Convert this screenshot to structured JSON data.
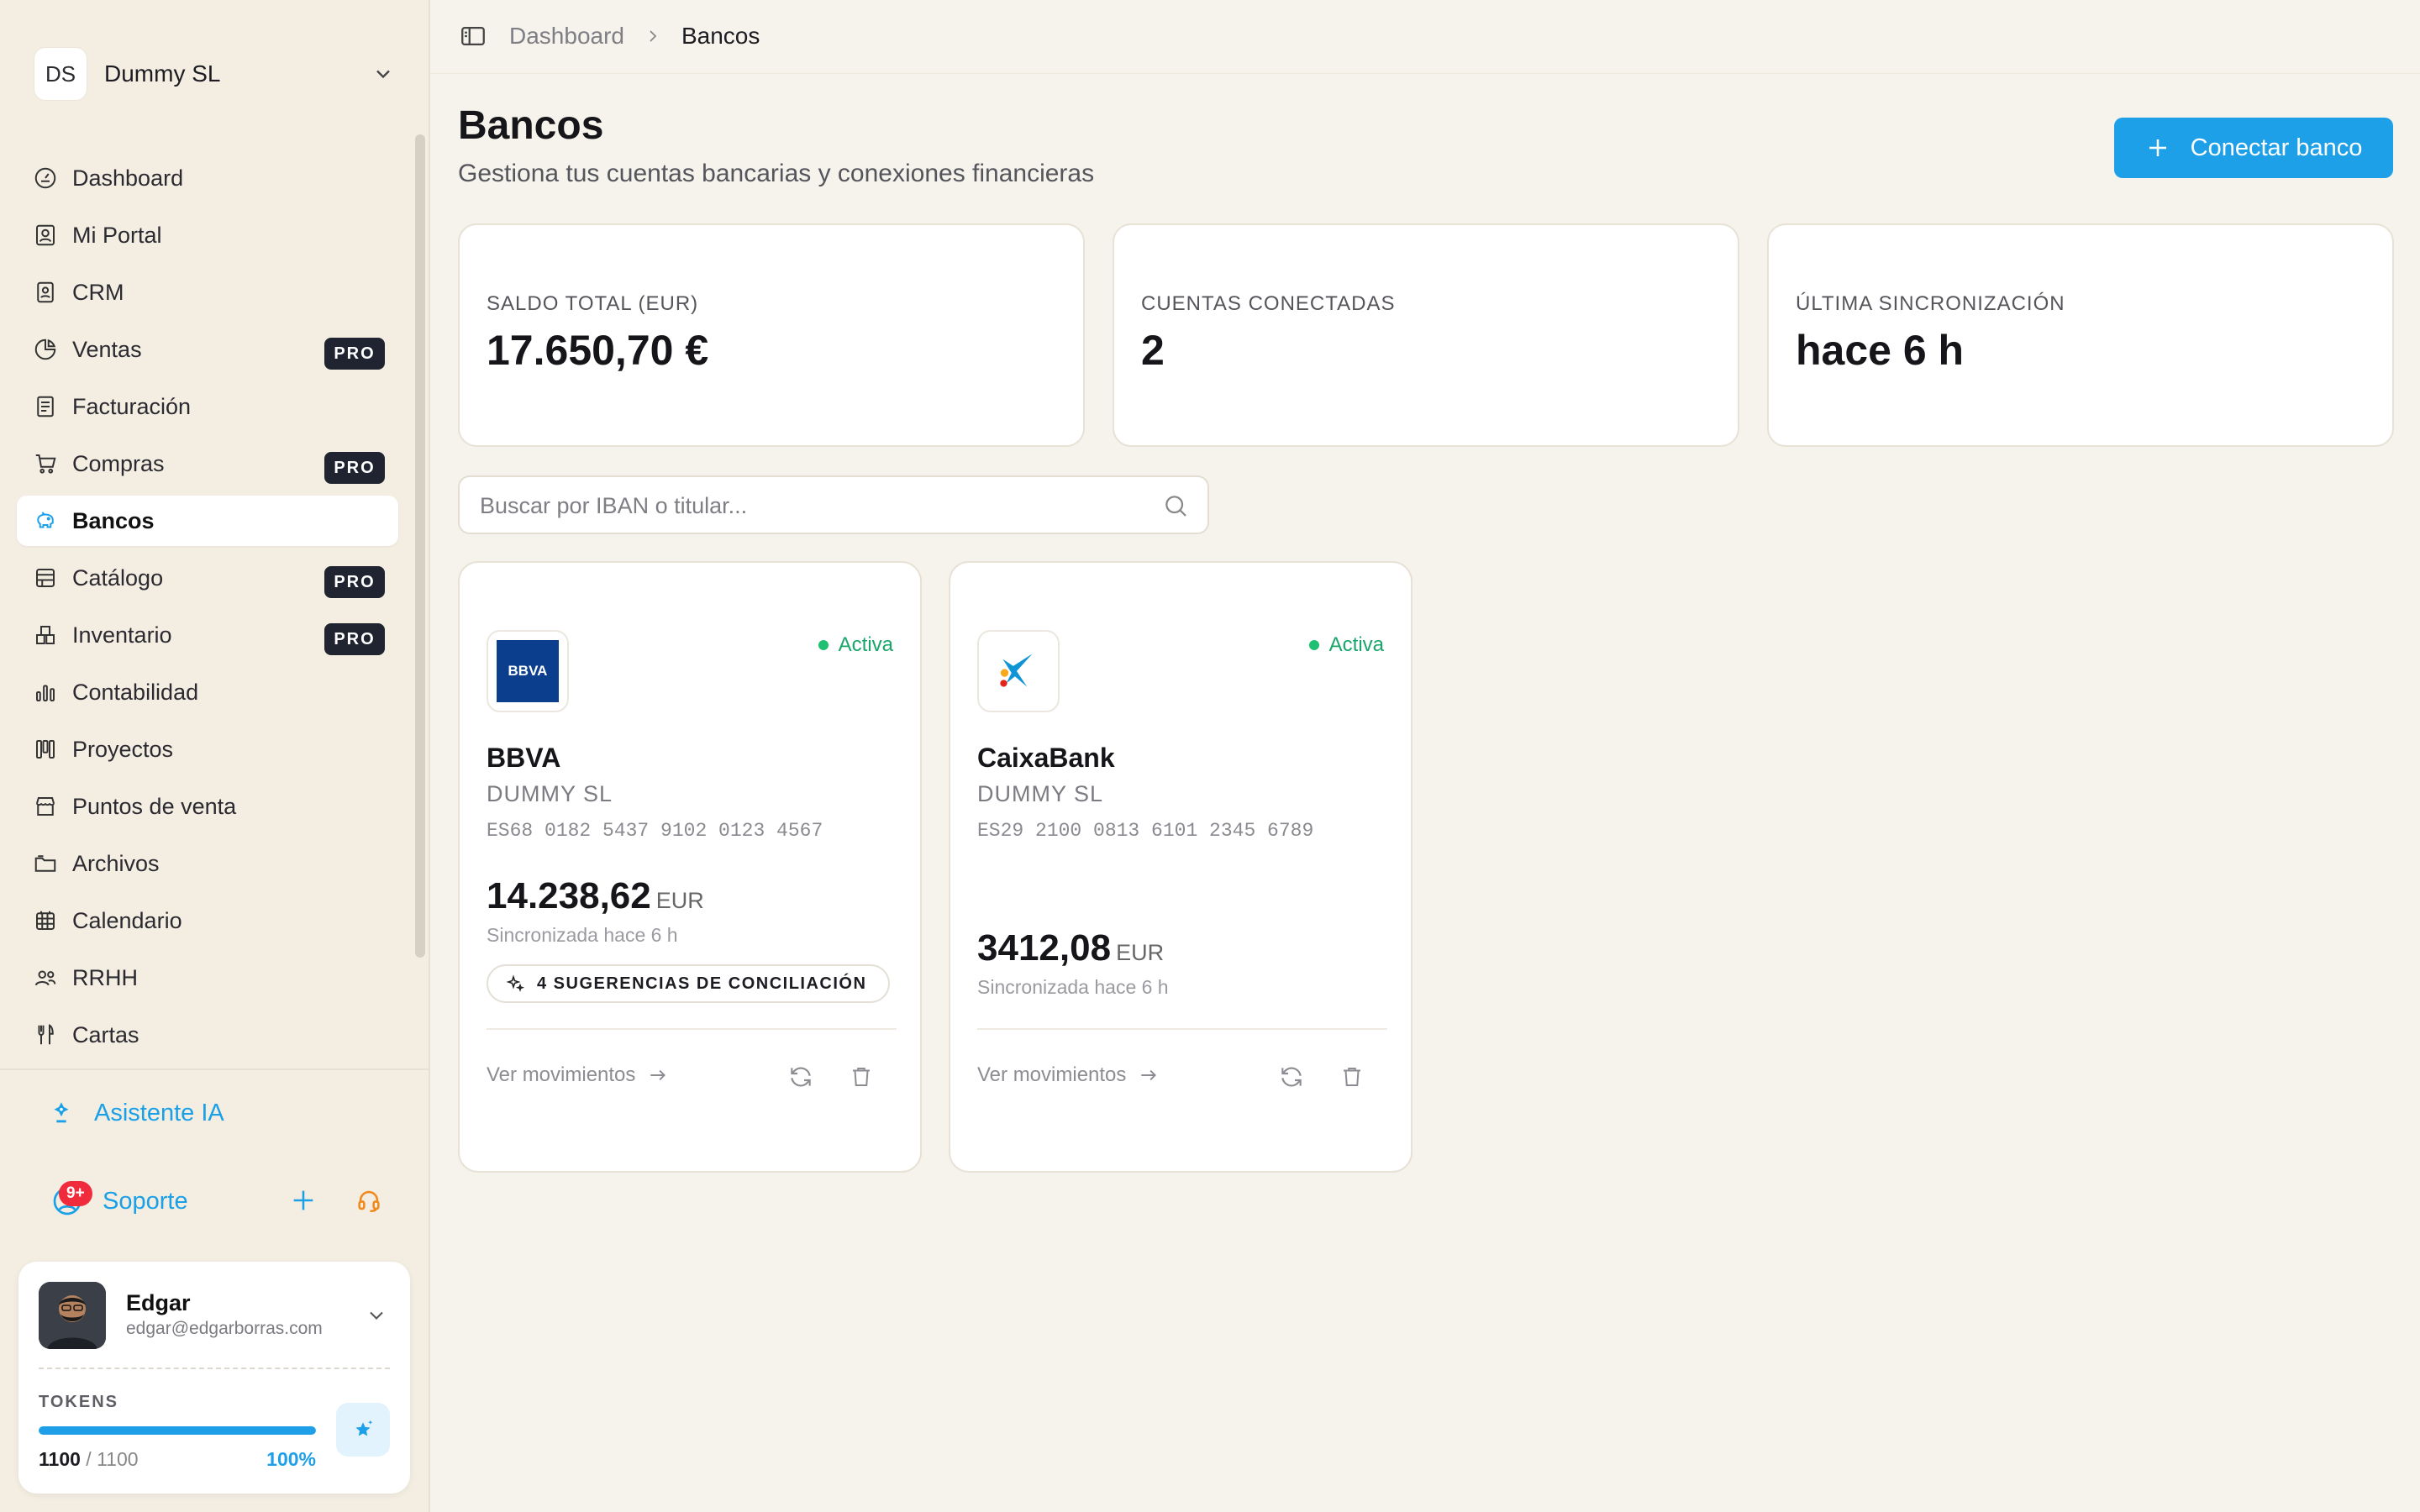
{
  "org": {
    "initials": "DS",
    "name": "Dummy SL"
  },
  "nav": [
    {
      "label": "Dashboard",
      "icon": "dashboard-icon",
      "pro": false,
      "active": false
    },
    {
      "label": "Mi Portal",
      "icon": "portal-icon",
      "pro": false,
      "active": false
    },
    {
      "label": "CRM",
      "icon": "contact-card-icon",
      "pro": false,
      "active": false
    },
    {
      "label": "Ventas",
      "icon": "pie-chart-icon",
      "pro": true,
      "active": false
    },
    {
      "label": "Facturación",
      "icon": "invoice-icon",
      "pro": false,
      "active": false
    },
    {
      "label": "Compras",
      "icon": "cart-icon",
      "pro": true,
      "active": false
    },
    {
      "label": "Bancos",
      "icon": "piggy-bank-icon",
      "pro": false,
      "active": true
    },
    {
      "label": "Catálogo",
      "icon": "catalog-icon",
      "pro": true,
      "active": false
    },
    {
      "label": "Inventario",
      "icon": "boxes-icon",
      "pro": true,
      "active": false
    },
    {
      "label": "Contabilidad",
      "icon": "bar-chart-icon",
      "pro": false,
      "active": false
    },
    {
      "label": "Proyectos",
      "icon": "kanban-icon",
      "pro": false,
      "active": false
    },
    {
      "label": "Puntos de venta",
      "icon": "store-icon",
      "pro": false,
      "active": false
    },
    {
      "label": "Archivos",
      "icon": "folder-icon",
      "pro": false,
      "active": false
    },
    {
      "label": "Calendario",
      "icon": "calendar-icon",
      "pro": false,
      "active": false
    },
    {
      "label": "RRHH",
      "icon": "users-icon",
      "pro": false,
      "active": false
    },
    {
      "label": "Cartas",
      "icon": "utensils-icon",
      "pro": false,
      "active": false
    }
  ],
  "pro_label": "PRO",
  "assistant_label": "Asistente IA",
  "support": {
    "label": "Soporte",
    "badge": "9+"
  },
  "user": {
    "name": "Edgar",
    "email": "edgar@edgarborras.com",
    "tokens_label": "TOKENS",
    "tokens_used": "1100",
    "tokens_total": "/ 1100",
    "tokens_pct": "100%",
    "tokens_fraction": 1.0
  },
  "breadcrumb": {
    "parent": "Dashboard",
    "current": "Bancos"
  },
  "page": {
    "title": "Bancos",
    "subtitle": "Gestiona tus cuentas bancarias y conexiones financieras",
    "connect_label": "Conectar banco"
  },
  "stats": [
    {
      "label": "SALDO TOTAL (EUR)",
      "value": "17.650,70 €"
    },
    {
      "label": "CUENTAS CONECTADAS",
      "value": "2"
    },
    {
      "label": "ÚLTIMA SINCRONIZACIÓN",
      "value": "hace 6 h"
    }
  ],
  "search": {
    "placeholder": "Buscar por IBAN o titular..."
  },
  "banks": [
    {
      "logo": "bbva-logo",
      "logo_text": "BBVA",
      "status": "Activa",
      "name": "BBVA",
      "holder": "DUMMY SL",
      "iban": "ES68 0182 5437 9102 0123 4567",
      "amount": "14.238,62",
      "currency": "EUR",
      "synced": "Sincronizada hace 6 h",
      "suggestions": "4 SUGERENCIAS DE CONCILIACIÓN",
      "movements_label": "Ver movimientos"
    },
    {
      "logo": "caixabank-logo",
      "status": "Activa",
      "name": "CaixaBank",
      "holder": "DUMMY SL",
      "iban": "ES29 2100 0813 6101 2345 6789",
      "amount": "3412,08",
      "currency": "EUR",
      "synced": "Sincronizada hace 6 h",
      "suggestions": "",
      "movements_label": "Ver movimientos"
    }
  ],
  "colors": {
    "accent": "#1ea0e8",
    "active_status": "#1aa66a",
    "pro_badge": "#1f2430",
    "badge_red": "#ef2b3c"
  }
}
